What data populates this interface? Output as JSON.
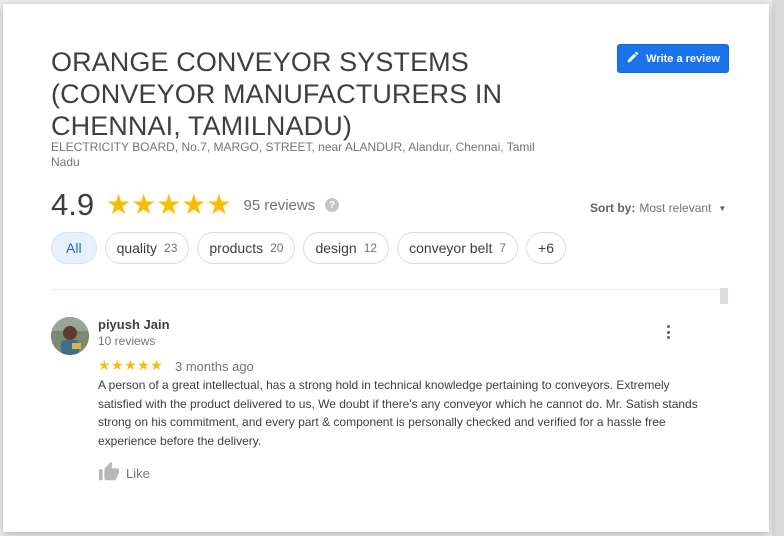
{
  "business": {
    "title": "ORANGE CONVEYOR SYSTEMS (CONVEYOR MANUFACTURERS IN CHENNAI, TAMILNADU)",
    "address": "ELECTRICITY BOARD, No.7, MARGO, STREET, near ALANDUR, Alandur, Chennai, Tamil Nadu"
  },
  "write_review": {
    "label": "Write a review",
    "icon": "pencil-icon"
  },
  "rating": {
    "value": "4.9",
    "stars": "★★★★★",
    "reviews": "95 reviews",
    "help": "?"
  },
  "sort": {
    "label": "Sort by:",
    "value": "Most relevant"
  },
  "chips": [
    {
      "label": "All",
      "count": ""
    },
    {
      "label": "quality",
      "count": "23"
    },
    {
      "label": "products",
      "count": "20"
    },
    {
      "label": "design",
      "count": "12"
    },
    {
      "label": "conveyor belt",
      "count": "7"
    },
    {
      "label": "+6",
      "count": ""
    }
  ],
  "review": {
    "name": "piyush Jain",
    "meta": "10 reviews",
    "stars": "★★★★★",
    "time": "3 months ago",
    "text": "A person of a great intellectual, has a strong hold in technical knowledge pertaining to conveyors. Extremely satisfied with the product delivered to us, We doubt if there's any conveyor which he cannot do. Mr. Satish stands strong on his commitment, and every part & component is personally checked and verified for a hassle free experience before the delivery.",
    "like_label": "Like"
  },
  "colors": {
    "accent": "#1a73e8",
    "star": "#fbbc04",
    "chip_active_bg": "#e8f0fe"
  }
}
